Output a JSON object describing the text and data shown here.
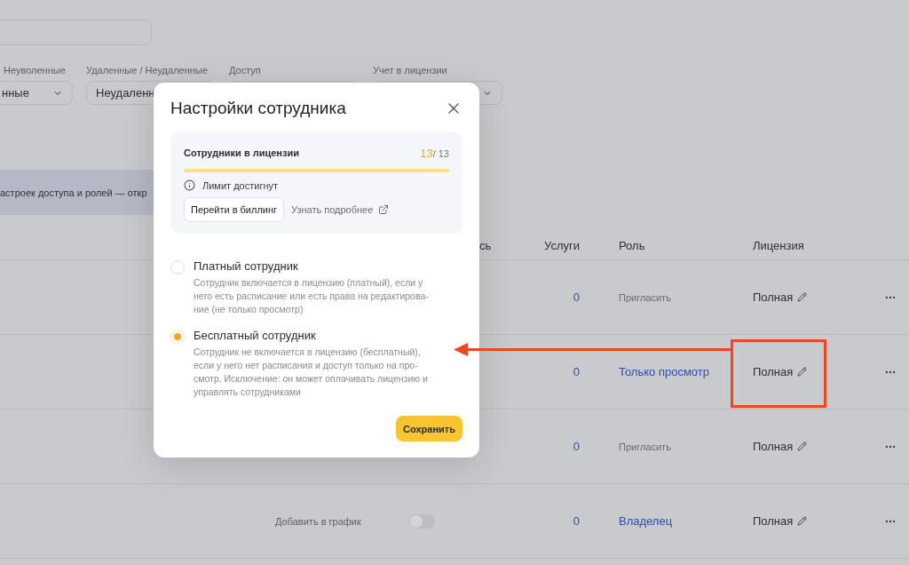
{
  "filters": [
    {
      "label": "Неуволенные",
      "value": "нные"
    },
    {
      "label": "Удаленные / Неудаленные",
      "value": "Неудаленн"
    },
    {
      "label": "Доступ"
    },
    {
      "label": "Учет в лицензии"
    }
  ],
  "banner": {
    "text": "астроек доступа и ролей — откр"
  },
  "table": {
    "columns": [
      "сь",
      "Услуги",
      "Роль",
      "Лицензия"
    ],
    "rows": [
      {
        "services": "0",
        "role": {
          "kind": "action",
          "text": "Пригласить"
        },
        "license": "Полная"
      },
      {
        "services": "0",
        "role": {
          "kind": "link",
          "text": "Только просмотр"
        },
        "license": "Полная"
      },
      {
        "services": "0",
        "role": {
          "kind": "action",
          "text": "Пригласить"
        },
        "license": "Полная"
      },
      {
        "schedule": {
          "label": "Добавить в график",
          "on": false
        },
        "services": "0",
        "role": {
          "kind": "link",
          "text": "Владелец"
        },
        "license": "Полная"
      }
    ]
  },
  "modal": {
    "title": "Настройки сотрудника",
    "license_card": {
      "label": "Сотрудники в лицензии",
      "used": "13",
      "total": "/ 13",
      "level": 1,
      "notice": "Лимит достигнут",
      "billing_button": "Перейти в биллинг",
      "more_link": "Узнать подробнее"
    },
    "options": [
      {
        "title": "Платный сотрудник",
        "description_lines": [
          "Сотрудник включается в лицензию (платный), если у",
          "него есть расписание или есть права на редактирова-",
          "ние (не только просмотр)"
        ],
        "selected": false
      },
      {
        "title": "Бесплатный сотрудник",
        "description_lines": [
          "Сотрудник не включается в лицензию (бесплатный),",
          "если у него нет расписания и доступ только на про-",
          "смотр. Исключение: он может оплачивать лицензию и",
          "управлять сотрудниками"
        ],
        "selected": true
      }
    ],
    "save_button": "Сохранить"
  }
}
